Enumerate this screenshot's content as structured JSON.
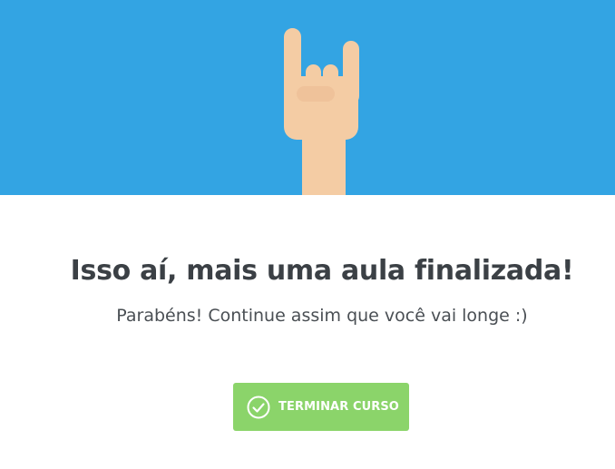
{
  "hero": {
    "illustration": "rock-hand-icon",
    "background_color": "#33a4e3",
    "skin_color": "#f4cca4"
  },
  "content": {
    "title": "Isso aí, mais uma aula finalizada!",
    "subtitle": "Parabéns! Continue assim que você vai longe :)"
  },
  "action": {
    "label": "TERMINAR CURSO",
    "icon": "check-circle-icon",
    "color": "#8bd46a"
  }
}
